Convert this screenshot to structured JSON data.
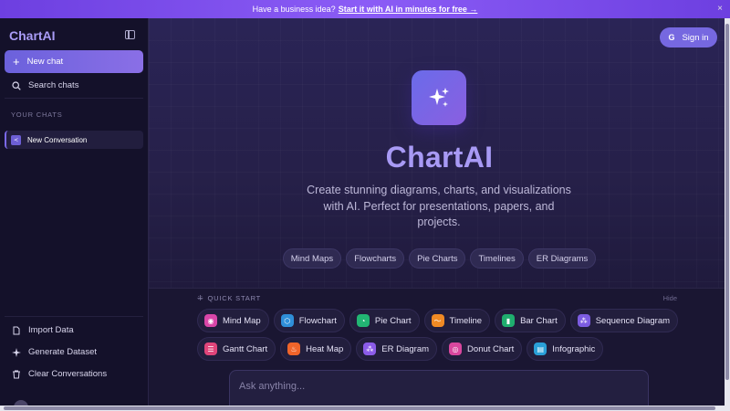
{
  "banner": {
    "text": "Have a business idea?",
    "cta": "Start it with AI in minutes for free →",
    "close": "×"
  },
  "sidebar": {
    "brand": "ChartAI",
    "new_chat": "New chat",
    "search": "Search chats",
    "section_label": "YOUR CHATS",
    "conversations": [
      {
        "label": "New Conversation",
        "icon": "chat-icon"
      }
    ],
    "bottom_items": [
      {
        "label": "Import Data",
        "icon": "import-icon"
      },
      {
        "label": "Generate Dataset",
        "icon": "sparkle-icon"
      },
      {
        "label": "Clear Conversations",
        "icon": "trash-icon"
      }
    ]
  },
  "header": {
    "signin": "Sign in",
    "google_glyph": "G"
  },
  "hero": {
    "title": "ChartAI",
    "description": "Create stunning diagrams, charts, and visualizations with AI. Perfect for presentations, papers, and projects.",
    "tags": [
      "Mind Maps",
      "Flowcharts",
      "Pie Charts",
      "Timelines",
      "ER Diagrams"
    ]
  },
  "quick_start": {
    "label": "QUICK START",
    "hide": "Hide",
    "row1": [
      {
        "label": "Mind Map",
        "icon": "mind-map-icon",
        "color": "#d946a8"
      },
      {
        "label": "Flowchart",
        "icon": "flowchart-icon",
        "color": "#2f8fd8"
      },
      {
        "label": "Pie Chart",
        "icon": "pie-chart-icon",
        "color": "#22b573"
      },
      {
        "label": "Timeline",
        "icon": "timeline-icon",
        "color": "#f08a24"
      },
      {
        "label": "Bar Chart",
        "icon": "bar-chart-icon",
        "color": "#1fae6e"
      },
      {
        "label": "Sequence Diagram",
        "icon": "sequence-icon",
        "color": "#7c5ce0"
      }
    ],
    "row2": [
      {
        "label": "Gantt Chart",
        "icon": "gantt-icon",
        "color": "#e0457a"
      },
      {
        "label": "Heat Map",
        "icon": "heat-map-icon",
        "color": "#f0642a"
      },
      {
        "label": "ER Diagram",
        "icon": "er-diagram-icon",
        "color": "#8b5ce8"
      },
      {
        "label": "Donut Chart",
        "icon": "donut-chart-icon",
        "color": "#d9479e"
      },
      {
        "label": "Infographic",
        "icon": "infographic-icon",
        "color": "#2aa0d8"
      }
    ]
  },
  "ask": {
    "placeholder": "Ask anything..."
  }
}
